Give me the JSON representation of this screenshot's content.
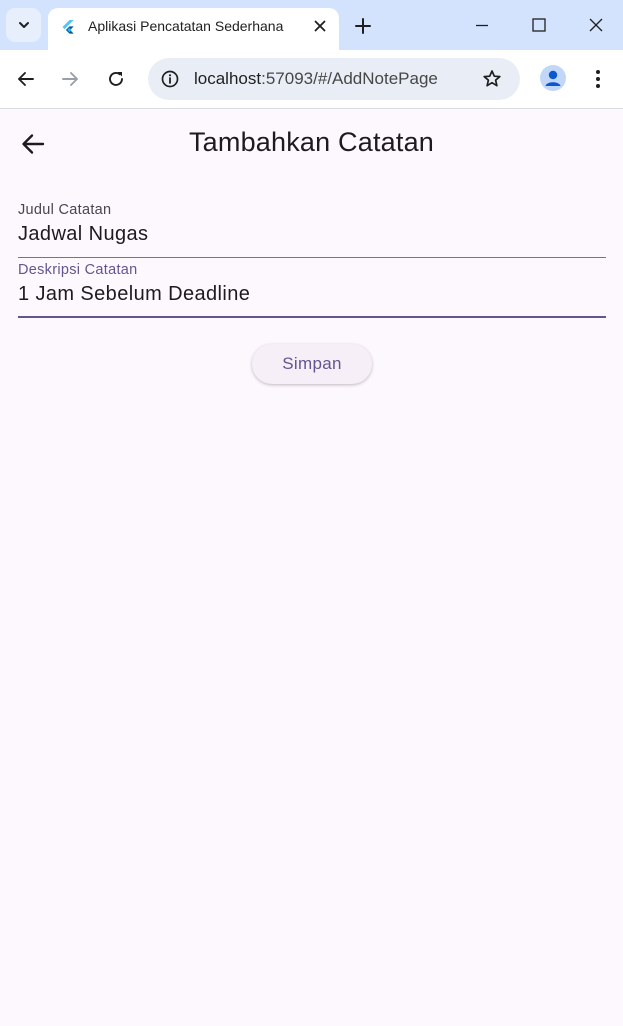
{
  "browser": {
    "tab_title": "Aplikasi Pencatatan Sederhana",
    "url_host": "localhost",
    "url_rest": ":57093/#/AddNotePage",
    "icons": {
      "tab_search": "chevron-down-icon",
      "favicon": "flutter-icon",
      "tab_close": "close-icon",
      "new_tab": "plus-icon",
      "minimize": "minimize-icon",
      "maximize": "maximize-icon",
      "close_window": "close-icon",
      "back": "arrow-left-icon",
      "forward": "arrow-right-icon",
      "reload": "reload-icon",
      "site_info": "info-icon",
      "bookmark": "star-icon",
      "profile": "person-icon",
      "menu": "more-vert-icon"
    }
  },
  "app": {
    "title": "Tambahkan Catatan",
    "back_icon": "arrow-back-icon",
    "fields": {
      "judul": {
        "label": "Judul Catatan",
        "value": "Jadwal Nugas"
      },
      "deskripsi": {
        "label": "Deskripsi Catatan",
        "value": "1 Jam Sebelum Deadline"
      }
    },
    "save_label": "Simpan"
  },
  "colors": {
    "background": "#fdf7fe",
    "primary": "#65558f",
    "tabstrip": "#d3e3fd",
    "omnibox": "#e9eef6",
    "text": "#1d1b20"
  }
}
